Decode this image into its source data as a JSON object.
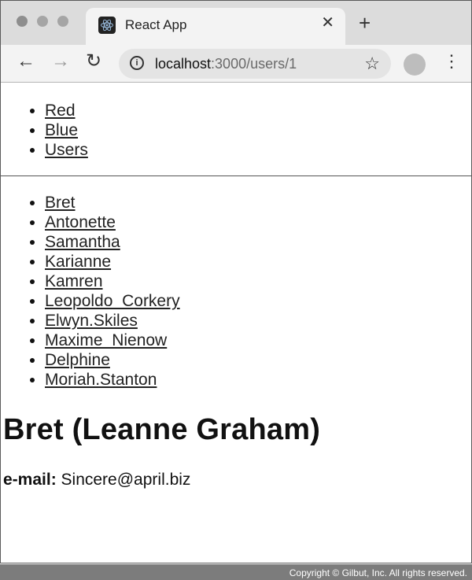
{
  "browser": {
    "tab_title": "React App",
    "url_host": "localhost",
    "url_path": ":3000/users/1"
  },
  "nav": [
    "Red",
    "Blue",
    "Users"
  ],
  "users": [
    "Bret",
    "Antonette",
    "Samantha",
    "Karianne",
    "Kamren",
    "Leopoldo_Corkery",
    "Elwyn.Skiles",
    "Maxime_Nienow",
    "Delphine",
    "Moriah.Stanton"
  ],
  "detail": {
    "heading": "Bret (Leanne Graham)",
    "email_label": "e-mail:",
    "email_value": "Sincere@april.biz"
  },
  "footer": {
    "copyright": "Copyright © Gilbut, Inc. All rights reserved."
  }
}
